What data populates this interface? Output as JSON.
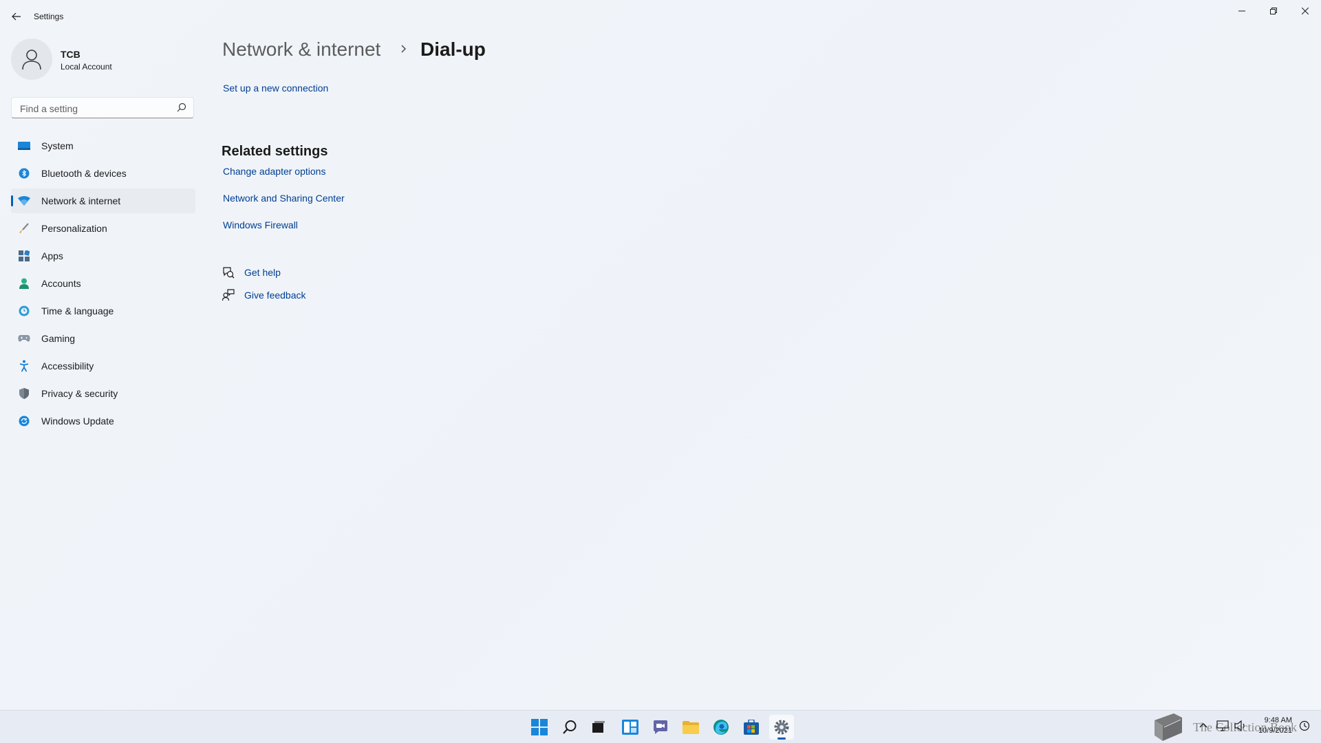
{
  "window": {
    "title": "Settings",
    "controls": [
      "minimize-icon",
      "restore-icon",
      "close-icon"
    ]
  },
  "profile": {
    "name": "TCB",
    "account_type": "Local Account"
  },
  "search": {
    "placeholder": "Find a setting"
  },
  "sidebar": {
    "selected": "Network & internet",
    "items": [
      {
        "label": "System",
        "icon": "monitor-icon"
      },
      {
        "label": "Bluetooth & devices",
        "icon": "bluetooth-icon"
      },
      {
        "label": "Network & internet",
        "icon": "wifi-icon"
      },
      {
        "label": "Personalization",
        "icon": "brush-icon"
      },
      {
        "label": "Apps",
        "icon": "apps-icon"
      },
      {
        "label": "Accounts",
        "icon": "person-icon"
      },
      {
        "label": "Time & language",
        "icon": "globe-clock-icon"
      },
      {
        "label": "Gaming",
        "icon": "controller-icon"
      },
      {
        "label": "Accessibility",
        "icon": "accessibility-icon"
      },
      {
        "label": "Privacy & security",
        "icon": "shield-icon"
      },
      {
        "label": "Windows Update",
        "icon": "update-icon"
      }
    ]
  },
  "breadcrumb": {
    "parent": "Network & internet",
    "current": "Dial-up"
  },
  "main": {
    "setup_link": "Set up a new connection",
    "related_heading": "Related settings",
    "related_links": [
      "Change adapter options",
      "Network and Sharing Center",
      "Windows Firewall"
    ],
    "help": {
      "get_help": "Get help",
      "give_feedback": "Give feedback"
    }
  },
  "taskbar": {
    "apps": [
      "start-icon",
      "search-icon",
      "task-view-icon",
      "widgets-icon",
      "chat-icon",
      "file-explorer-icon",
      "edge-icon",
      "store-icon",
      "settings-icon"
    ],
    "active_app": "settings-icon",
    "tray_icons": [
      "chevron-up-icon",
      "network-icon",
      "volume-icon"
    ],
    "time": "9:48 AM",
    "date": "10/9/2021",
    "watermark": "The Collection Book"
  },
  "colors": {
    "accent": "#005fb8",
    "link": "#003e92",
    "background": "#f0f4f9"
  }
}
